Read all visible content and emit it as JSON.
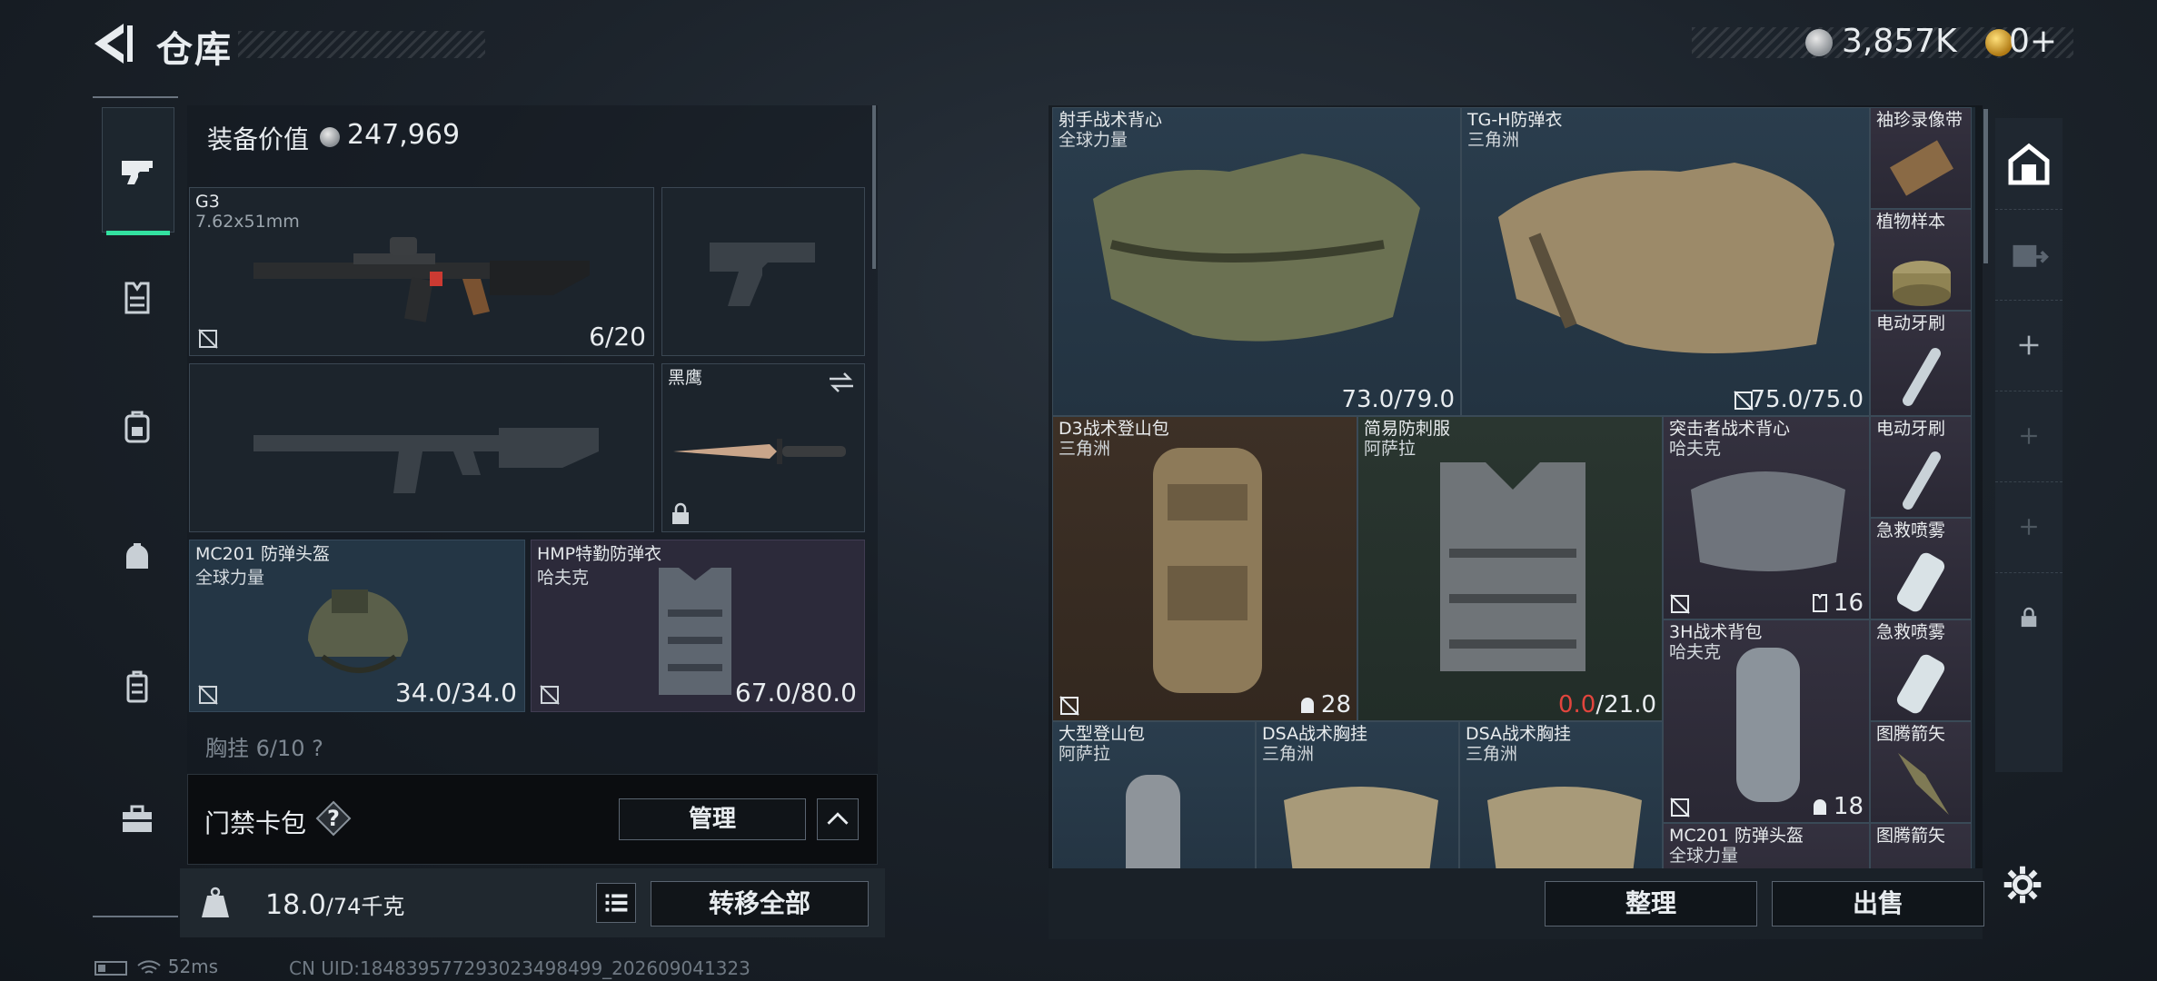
{
  "header": {
    "title": "仓库"
  },
  "currency": [
    {
      "name": "hafu-coin",
      "value": "3,857K",
      "color": "#c9ced3"
    },
    {
      "name": "premium-coin",
      "value": "0+",
      "color": "#e3b23c"
    }
  ],
  "currency_tiny_label": "###.####",
  "left_nav": [
    {
      "name": "nav-weapons",
      "icon": "pistol-icon"
    },
    {
      "name": "nav-armor",
      "icon": "chest-rig-icon"
    },
    {
      "name": "nav-backpack",
      "icon": "backpack-icon"
    },
    {
      "name": "nav-helmet-bag",
      "icon": "pouch-icon"
    },
    {
      "name": "nav-case",
      "icon": "container-icon"
    },
    {
      "name": "nav-toolbox",
      "icon": "toolbox-icon"
    }
  ],
  "equipment": {
    "value_label": "装备价值",
    "value": "247,969",
    "primary": {
      "name": "G3",
      "caliber": "7.62x51mm",
      "ammo": "6/20"
    },
    "knife": {
      "name": "黑鹰"
    },
    "helmet": {
      "name": "MC201 防弹头盔",
      "faction": "全球力量",
      "durability": "34.0/34.0"
    },
    "armor": {
      "name": "HMP特勤防弹衣",
      "faction": "哈夫克",
      "durability": "67.0/80.0"
    },
    "chest_rig_row": "胸挂  6/10  ?"
  },
  "card_bar": {
    "label": "门禁卡包",
    "help": "?",
    "manage": "管理"
  },
  "weight": {
    "current": "18.0",
    "max": "/74千克",
    "transfer": "转移全部"
  },
  "status": {
    "ping": "52ms",
    "uid": "CN UID:18483957729302349849​9_202609041323"
  },
  "stash": {
    "items": [
      {
        "name": "射手战术背心",
        "sub": "全球力量",
        "value": ""
      },
      {
        "name": "TG-H防弹衣",
        "sub": "三角洲",
        "value": "75.0/75.0"
      },
      {
        "name": "袖珍录像带",
        "sub": ""
      },
      {
        "name": "植物样本",
        "sub": ""
      },
      {
        "name": "电动牙刷",
        "sub": ""
      },
      {
        "name": "D3战术登山包",
        "sub": "三角洲",
        "count": "28"
      },
      {
        "name": "简易防刺服",
        "sub": "阿萨拉",
        "value_red": "0.0",
        "value": "/21.0"
      },
      {
        "name": "突击者战术背心",
        "sub": "哈夫克",
        "count": "16"
      },
      {
        "name": "电动牙刷",
        "sub": ""
      },
      {
        "name": "急救喷雾",
        "sub": ""
      },
      {
        "name": "3H战术背包",
        "sub": "哈夫克",
        "count": "18"
      },
      {
        "name": "急救喷雾",
        "sub": ""
      },
      {
        "name": "大型登山包",
        "sub": "阿萨拉"
      },
      {
        "name": "DSA战术胸挂",
        "sub": "三角洲"
      },
      {
        "name": "DSA战术胸挂",
        "sub": "三角洲"
      },
      {
        "name": "图腾箭矢",
        "sub": ""
      },
      {
        "name": "MC201 防弹头盔",
        "sub": "全球力量"
      },
      {
        "name": "图腾箭矢",
        "sub": ""
      }
    ],
    "first_vest_value": "73.0/79.0",
    "sort": "整理",
    "sell": "出售"
  }
}
